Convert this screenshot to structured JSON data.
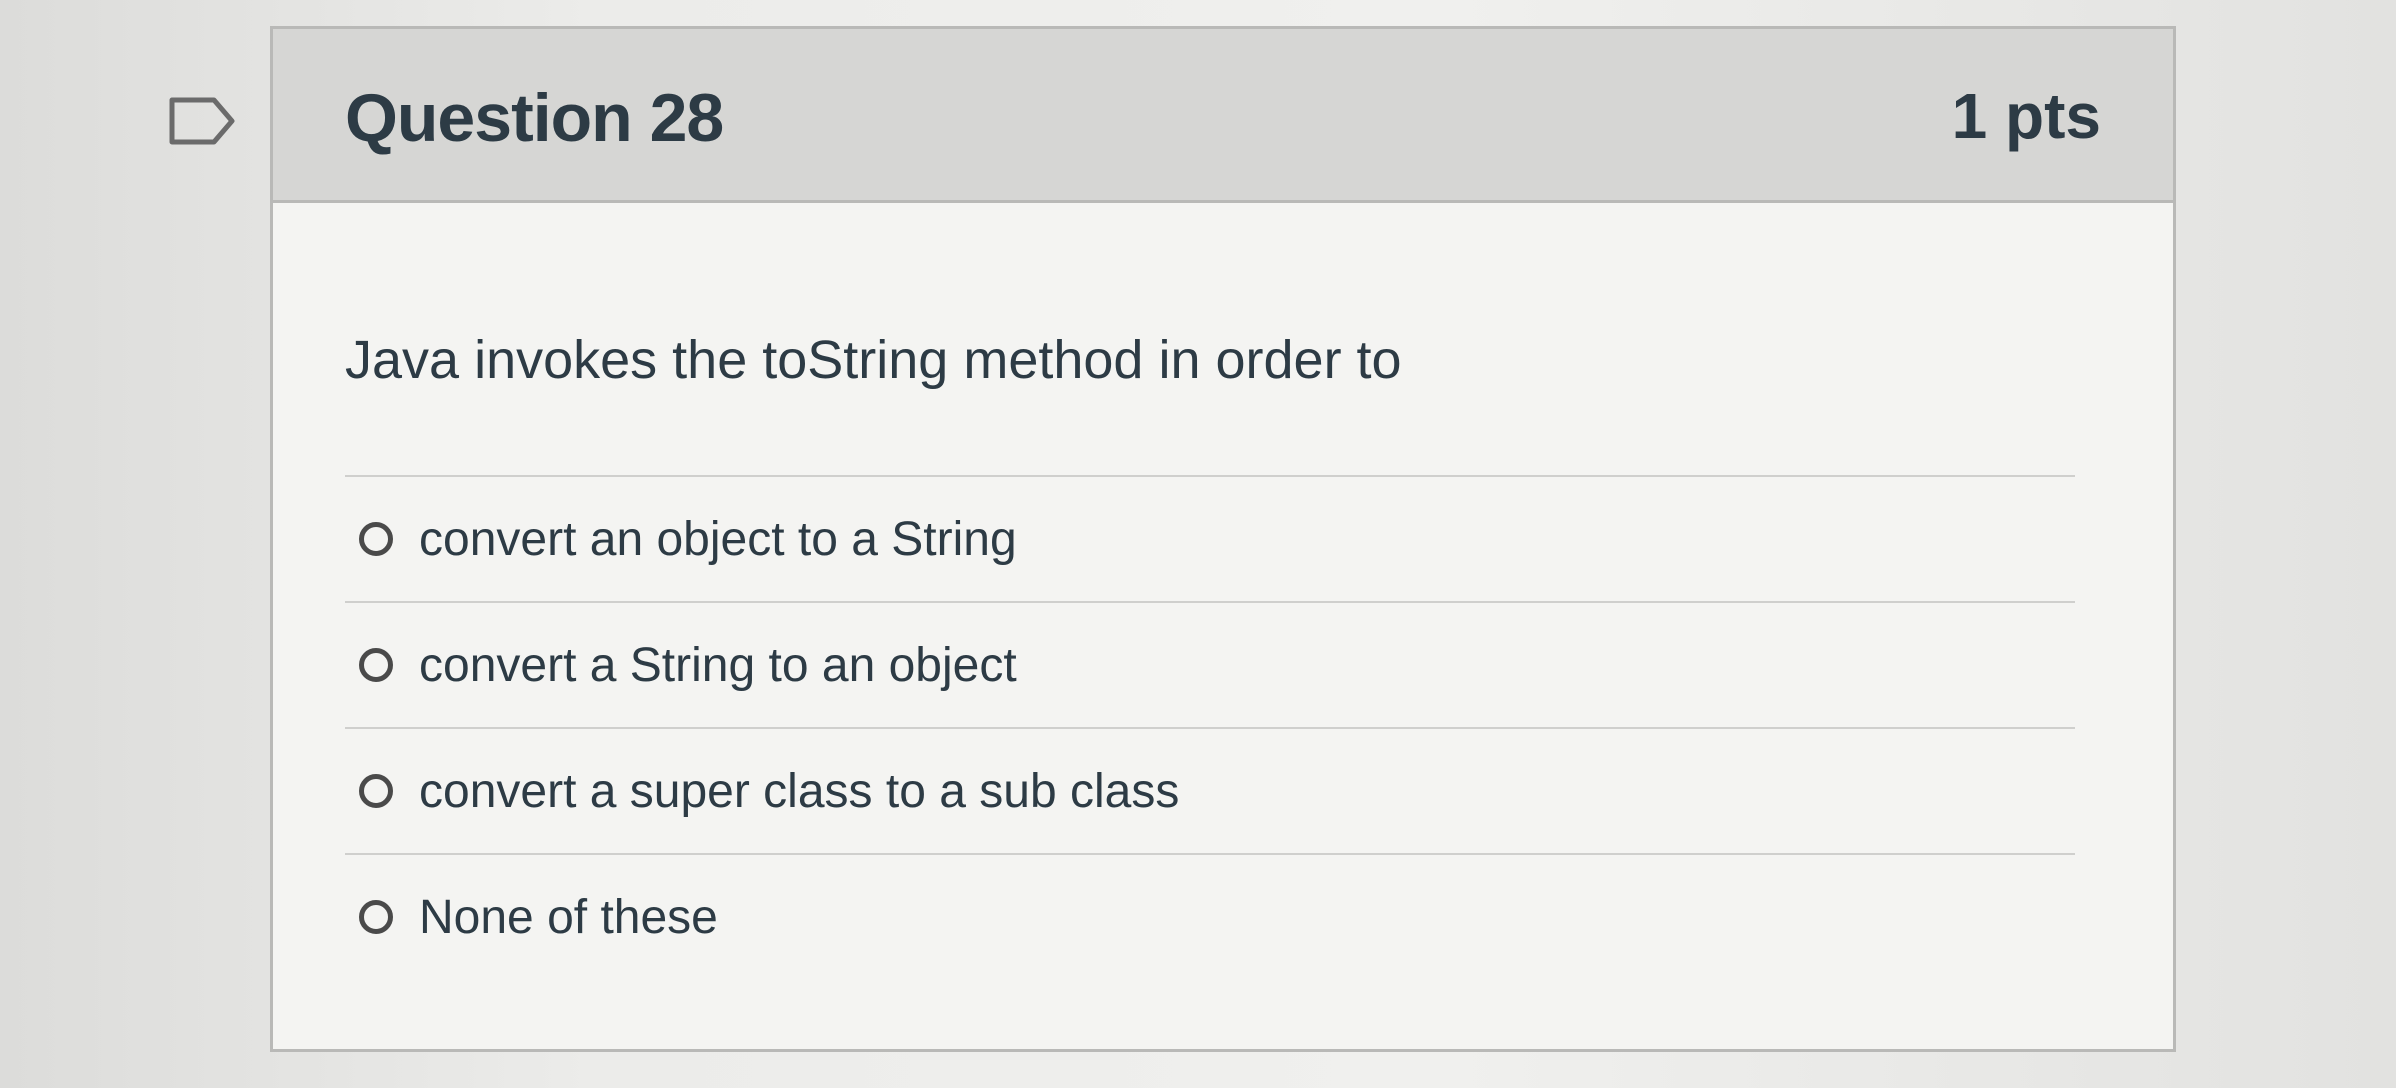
{
  "question": {
    "title": "Question 28",
    "points": "1 pts",
    "text": "Java invokes the toString method in order to",
    "answers": [
      {
        "label": "convert an object to a String",
        "selected": false
      },
      {
        "label": "convert a String to an object",
        "selected": false
      },
      {
        "label": "convert a super class to a sub class",
        "selected": false
      },
      {
        "label": "None of these",
        "selected": false
      }
    ]
  },
  "icons": {
    "flag": "flag-question-icon",
    "radio": "radio-unchecked-icon"
  },
  "colors": {
    "text": "#2d3b45",
    "header_bg": "#d6d6d4",
    "border": "#b9b9b7"
  }
}
